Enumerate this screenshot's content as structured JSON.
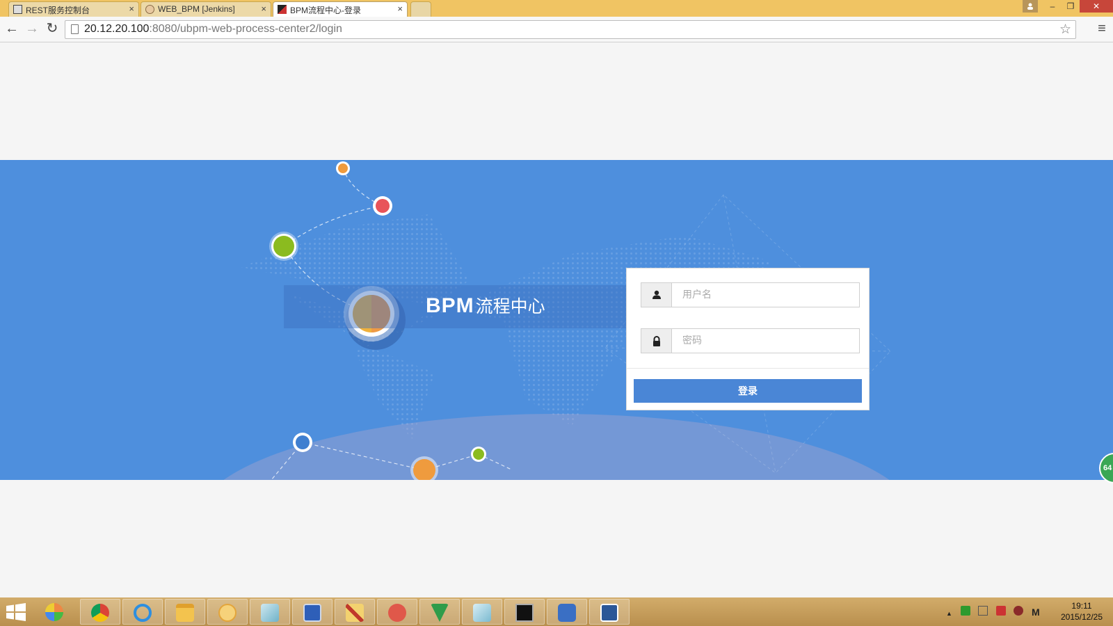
{
  "browser": {
    "tabs": [
      {
        "title": "REST服务控制台",
        "active": false,
        "icon": "rest-favicon"
      },
      {
        "title": "WEB_BPM [Jenkins]",
        "active": false,
        "icon": "jenkins-favicon"
      },
      {
        "title": "BPM流程中心-登录",
        "active": true,
        "icon": "bpm-favicon"
      }
    ],
    "tab_close_glyph": "×",
    "window_buttons": {
      "minimize": "–",
      "restore": "❐",
      "close": "✕"
    },
    "address": {
      "host": "20.12.20.100",
      "rest": ":8080/ubpm-web-process-center2/login"
    },
    "nav": {
      "back": "←",
      "forward": "→",
      "reload": "↻",
      "star": "☆",
      "menu": "≡"
    }
  },
  "brand": {
    "logo_latin": "BPM",
    "logo_cn": "流程中心"
  },
  "login": {
    "username_placeholder": "用户名",
    "password_placeholder": "密码",
    "submit_label": "登录"
  },
  "floating_widget": {
    "label": "64"
  },
  "taskbar": {
    "apps": [
      "start-icon",
      "colorful-app-icon",
      "chrome-icon",
      "ie-icon",
      "file-explorer-icon",
      "outlook-icon",
      "notes-icon",
      "remote-desktop-icon",
      "tools-icon",
      "snail-icon",
      "green-app-icon",
      "notes2-icon",
      "cmd-icon",
      "sync-icon",
      "word-icon"
    ],
    "tray_m": "M",
    "tray_arrow": "▲",
    "clock_time": "19:11",
    "clock_date": "2015/12/25"
  },
  "colors": {
    "banner": "#4e8fdd",
    "button": "#4a86d6",
    "titlebar": "#f0c463"
  }
}
